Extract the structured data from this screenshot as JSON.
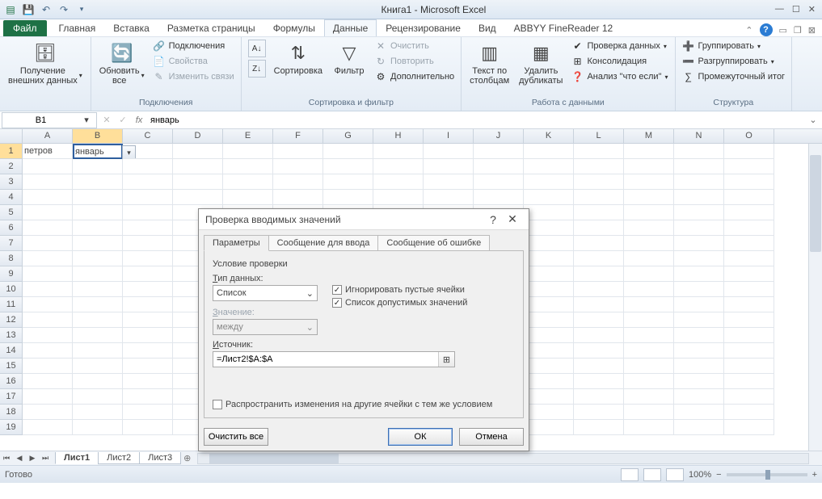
{
  "title": "Книга1  -  Microsoft Excel",
  "qat_icons": [
    "excel-icon",
    "save-icon",
    "undo-icon",
    "redo-icon",
    "customize-qat-icon"
  ],
  "file_tab": "Файл",
  "tabs": [
    "Главная",
    "Вставка",
    "Разметка страницы",
    "Формулы",
    "Данные",
    "Рецензирование",
    "Вид",
    "ABBYY FineReader 12"
  ],
  "active_tab_index": 4,
  "ribbon": {
    "groups": [
      {
        "label": "",
        "items": [
          {
            "big": "Получение\nвнешних данных",
            "icon": "external-data-icon",
            "drop": true
          }
        ]
      },
      {
        "label": "Подключения",
        "items": [
          {
            "big": "Обновить\nвсе",
            "icon": "refresh-icon",
            "drop": true
          },
          {
            "small": [
              "Подключения",
              "Свойства",
              "Изменить связи"
            ],
            "sicons": [
              "connections-icon",
              "properties-icon",
              "edit-links-icon"
            ],
            "disabled": [
              false,
              true,
              true
            ]
          }
        ]
      },
      {
        "label": "Сортировка и фильтр",
        "items": [
          {
            "stack_icons": [
              "sort-asc-icon",
              "sort-desc-icon"
            ]
          },
          {
            "big": "Сортировка",
            "icon": "sort-icon"
          },
          {
            "big": "Фильтр",
            "icon": "filter-icon"
          },
          {
            "small": [
              "Очистить",
              "Повторить",
              "Дополнительно"
            ],
            "sicons": [
              "clear-icon",
              "reapply-icon",
              "advanced-icon"
            ],
            "disabled": [
              true,
              true,
              false
            ]
          }
        ]
      },
      {
        "label": "Работа с данными",
        "items": [
          {
            "big": "Текст по\nстолбцам",
            "icon": "text-to-columns-icon"
          },
          {
            "big": "Удалить\nдубликаты",
            "icon": "remove-duplicates-icon"
          },
          {
            "small": [
              "Проверка данных",
              "Консолидация",
              "Анализ \"что если\""
            ],
            "sicons": [
              "data-validation-icon",
              "consolidate-icon",
              "what-if-icon"
            ],
            "drops": [
              true,
              false,
              true
            ]
          }
        ]
      },
      {
        "label": "Структура",
        "items": [
          {
            "small": [
              "Группировать",
              "Разгруппировать",
              "Промежуточный итог"
            ],
            "sicons": [
              "group-icon",
              "ungroup-icon",
              "subtotal-icon"
            ],
            "drops": [
              true,
              true,
              false
            ]
          }
        ]
      }
    ]
  },
  "namebox": "B1",
  "formula": "январь",
  "columns": [
    "A",
    "B",
    "C",
    "D",
    "E",
    "F",
    "G",
    "H",
    "I",
    "J",
    "K",
    "L",
    "M",
    "N",
    "O"
  ],
  "selected_col_index": 1,
  "rows": 19,
  "selected_row_index": 0,
  "cells": {
    "A1": "петров",
    "B1": "январь"
  },
  "sheets": [
    "Лист1",
    "Лист2",
    "Лист3"
  ],
  "active_sheet_index": 0,
  "status": "Готово",
  "zoom": "100%",
  "dialog": {
    "title": "Проверка вводимых значений",
    "tabs": [
      "Параметры",
      "Сообщение для ввода",
      "Сообщение об ошибке"
    ],
    "active_tab": 0,
    "group_label": "Условие проверки",
    "type_label": "Тип данных:",
    "type_value": "Список",
    "ignore_blank": "Игнорировать пустые ячейки",
    "in_cell_dropdown": "Список допустимых значений",
    "data_label": "Значение:",
    "data_value": "между",
    "source_label": "Источник:",
    "source_value": "=Лист2!$A:$A",
    "apply_changes": "Распространить изменения на другие ячейки с тем же условием",
    "clear_all": "Очистить все",
    "ok": "ОК",
    "cancel": "Отмена"
  }
}
